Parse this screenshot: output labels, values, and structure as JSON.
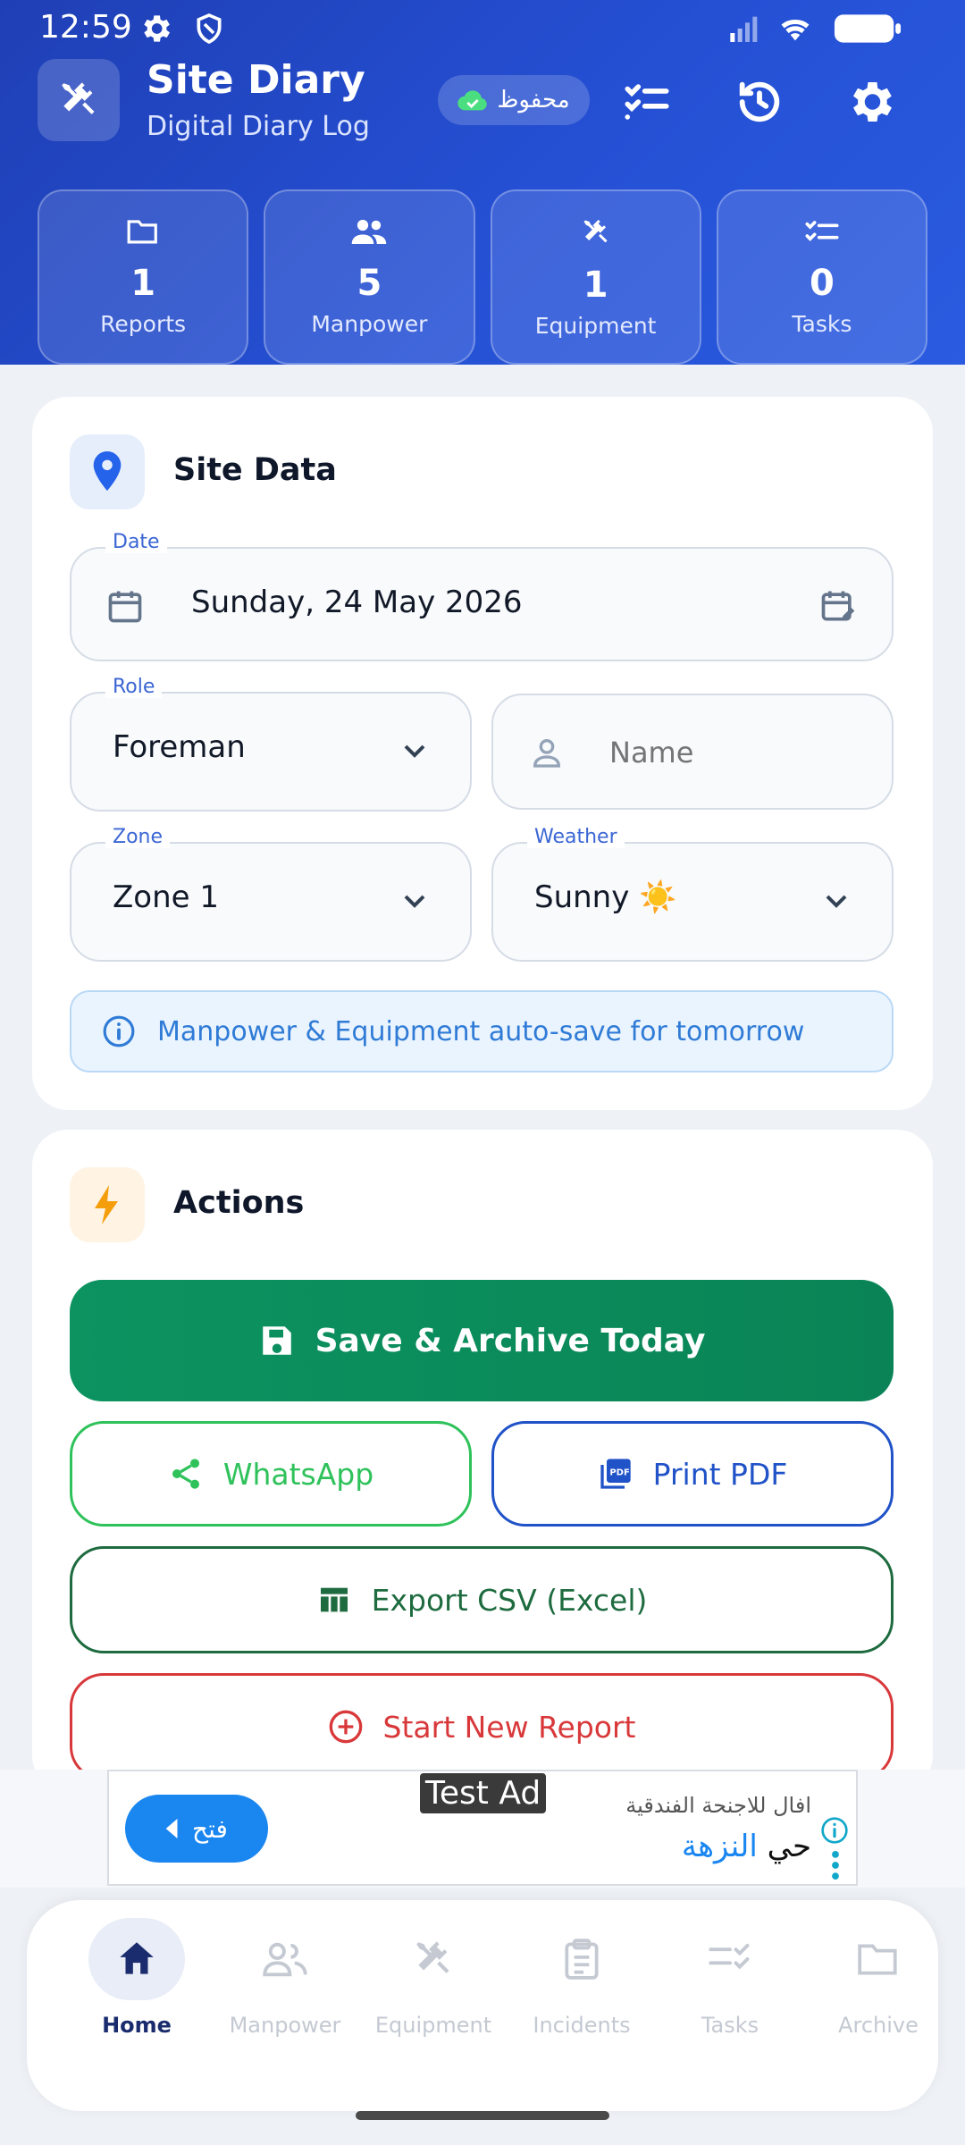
{
  "status_bar": {
    "time": "12:59"
  },
  "header": {
    "title": "Site Diary",
    "subtitle": "Digital Diary Log",
    "saved_label": "محفوظ"
  },
  "stats": [
    {
      "value": "1",
      "label": "Reports",
      "icon": "folder-icon"
    },
    {
      "value": "5",
      "label": "Manpower",
      "icon": "people-icon"
    },
    {
      "value": "1",
      "label": "Equipment",
      "icon": "tools-icon"
    },
    {
      "value": "0",
      "label": "Tasks",
      "icon": "checklist-icon"
    }
  ],
  "site_data": {
    "title": "Site Data",
    "date": {
      "label": "Date",
      "value": "Sunday, 24 May 2026"
    },
    "role": {
      "label": "Role",
      "value": "Foreman"
    },
    "name": {
      "placeholder": "Name"
    },
    "zone": {
      "label": "Zone",
      "value": "Zone 1"
    },
    "weather": {
      "label": "Weather",
      "value": "Sunny ☀️"
    },
    "info": "Manpower & Equipment auto-save for tomorrow"
  },
  "actions": {
    "title": "Actions",
    "save_archive": "Save & Archive Today",
    "whatsapp": "WhatsApp",
    "print_pdf": "Print PDF",
    "export_csv": "Export CSV (Excel)",
    "new_report": "Start New Report"
  },
  "ad": {
    "tag": "Test Ad",
    "open_label": "فتح",
    "line1": "افال للاجنحة الفندقية",
    "line2_blue": "النزهة",
    "line2_black": "حي"
  },
  "nav": [
    {
      "label": "Home",
      "icon": "home-icon",
      "active": true
    },
    {
      "label": "Manpower",
      "icon": "people-icon",
      "active": false
    },
    {
      "label": "Equipment",
      "icon": "tools-icon",
      "active": false
    },
    {
      "label": "Incidents",
      "icon": "clipboard-icon",
      "active": false
    },
    {
      "label": "Tasks",
      "icon": "checklist-icon",
      "active": false
    },
    {
      "label": "Archive",
      "icon": "folder-icon",
      "active": false
    }
  ],
  "colors": {
    "header": "#2550d4",
    "primary": "#0c9360",
    "whatsapp": "#2fc25b",
    "pdf": "#2052c8",
    "csv": "#1e6b3f",
    "danger": "#d9383a"
  }
}
